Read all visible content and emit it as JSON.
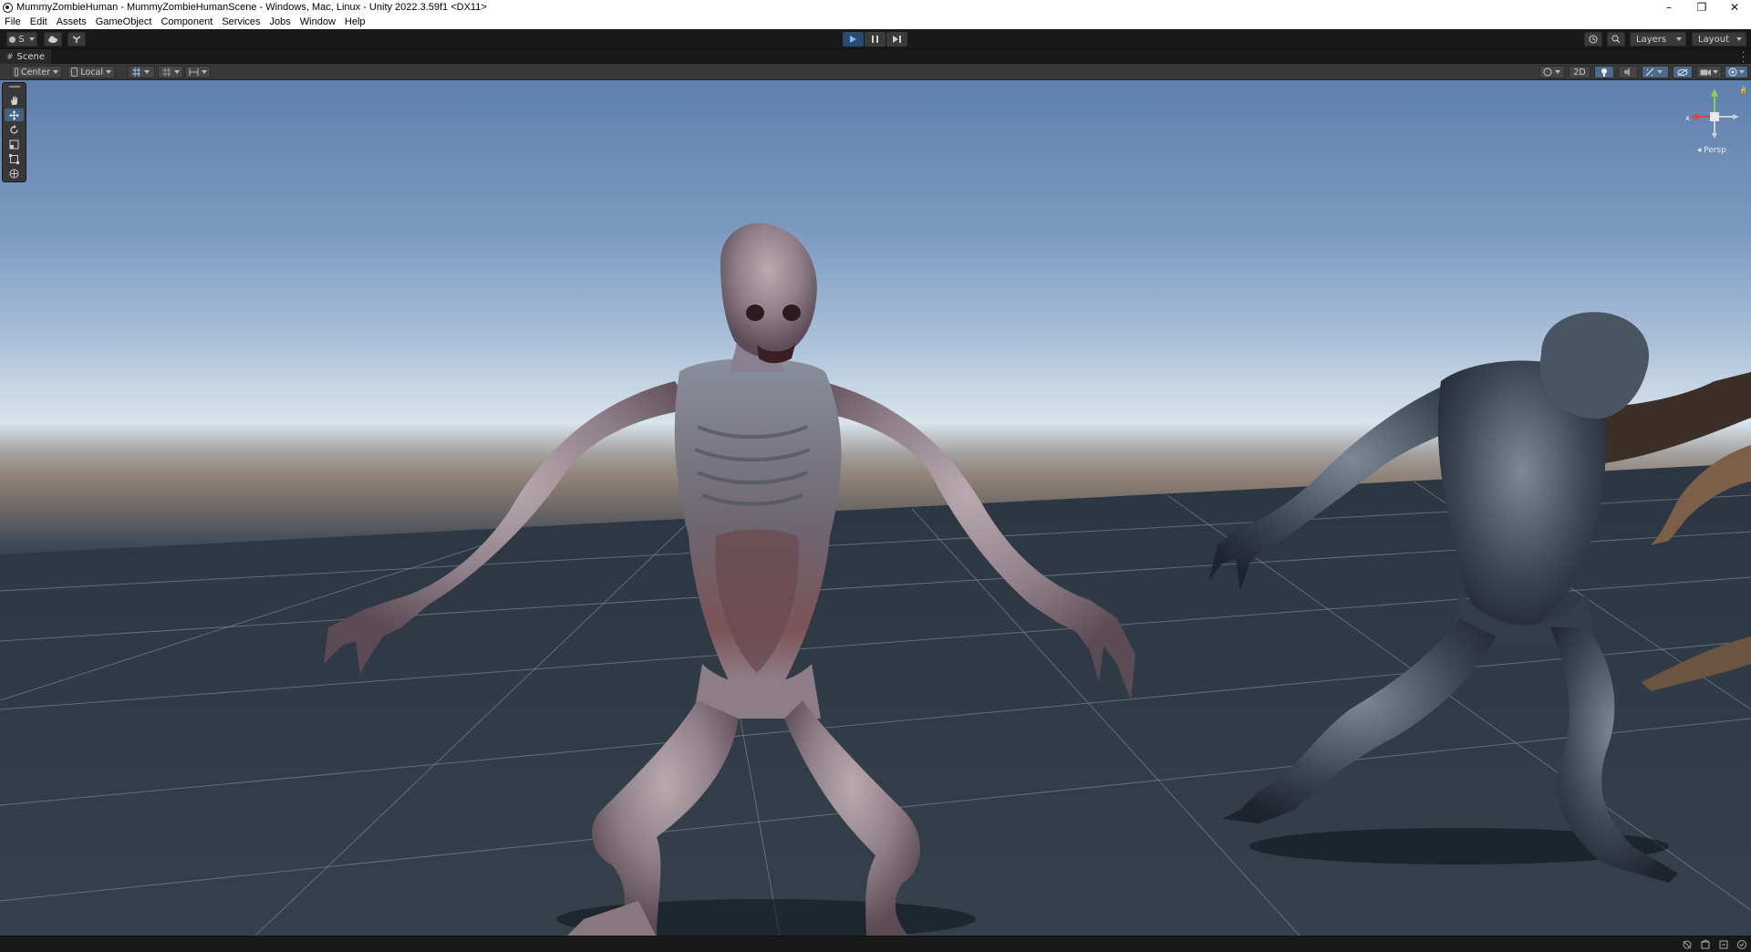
{
  "window": {
    "title": "MummyZombieHuman - MummyZombieHumanScene - Windows, Mac, Linux - Unity 2022.3.59f1 <DX11>",
    "controls": {
      "minimize": "–",
      "maximize": "❐",
      "close": "✕"
    }
  },
  "menu": [
    "File",
    "Edit",
    "Assets",
    "GameObject",
    "Component",
    "Services",
    "Jobs",
    "Window",
    "Help"
  ],
  "toolbar": {
    "account_label": "S",
    "layers_label": "Layers",
    "layout_label": "Layout",
    "play_state": "playing"
  },
  "scene_tab": {
    "label": "Scene"
  },
  "scene_toolbar": {
    "pivot_label": "Center",
    "space_label": "Local",
    "mode_2d_label": "2D"
  },
  "gizmo": {
    "projection_label": "Persp",
    "x_axis": "x",
    "colors": {
      "x": "#e0453a",
      "y": "#8fd04a",
      "z": "#3a7be0"
    }
  },
  "icons": {
    "tools": [
      "hand-tool-icon",
      "move-tool-icon",
      "rotate-tool-icon",
      "scale-tool-icon",
      "rect-tool-icon",
      "transform-tool-icon"
    ],
    "status": [
      "debug-icon",
      "package-icon",
      "cache-icon",
      "console-icon"
    ]
  },
  "colors": {
    "accent_blue": "#4d6a8a",
    "play_active": "#2b4a6e",
    "editor_dark": "#191919",
    "toolbar_grey": "#383838"
  }
}
